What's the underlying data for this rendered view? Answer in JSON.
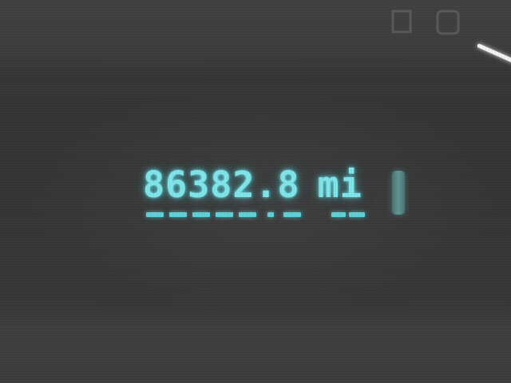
{
  "odometer": {
    "value": "86382.8",
    "unit": "mi"
  },
  "icons": {
    "needle": "needle-glint",
    "level": "level-indicator-icon"
  },
  "colors": {
    "lcd_text": "#7fe4e8",
    "lcd_underline": "#5fcfd6",
    "background": "#363636"
  }
}
